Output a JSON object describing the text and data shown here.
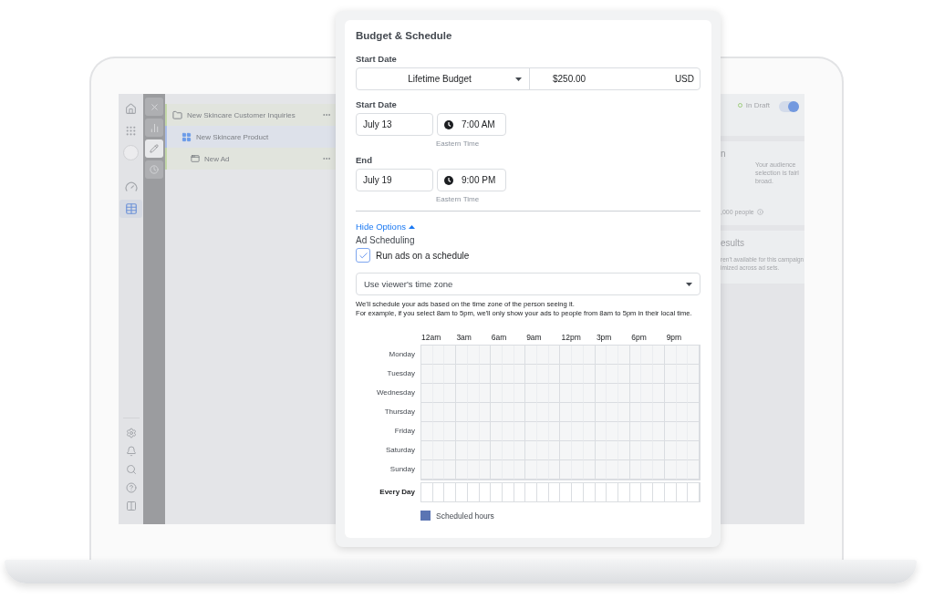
{
  "app": {
    "nav": [
      {
        "kind": "home",
        "selected": false
      },
      {
        "kind": "apps",
        "selected": false
      },
      {
        "kind": "brand",
        "selected": false
      },
      {
        "kind": "gauge",
        "selected": false
      },
      {
        "kind": "table",
        "selected": true
      }
    ],
    "nav_bottom": [
      {
        "kind": "settings"
      },
      {
        "kind": "alerts"
      },
      {
        "kind": "search"
      },
      {
        "kind": "help"
      },
      {
        "kind": "panel"
      }
    ],
    "tools": [
      {
        "kind": "close",
        "selected": false
      },
      {
        "kind": "chart",
        "selected": false
      },
      {
        "kind": "edit",
        "selected": true
      },
      {
        "kind": "history",
        "selected": false
      }
    ],
    "tree": [
      {
        "label": "New Skincare Customer Inquiries",
        "kind": "campaign",
        "selected": false,
        "has_menu": true,
        "children": [
          {
            "label": "New Skincare Product",
            "kind": "adset",
            "selected": true,
            "has_menu": false,
            "children": [
              {
                "label": "New Ad",
                "kind": "ad",
                "selected": false,
                "has_menu": true
              }
            ]
          }
        ]
      }
    ],
    "status": {
      "label": "In Draft",
      "on": true
    },
    "audience_card": {
      "title": "n",
      "note": "Your audience\nselection is fairl\nbroad.",
      "reach": ",000 people"
    },
    "results_card": {
      "title": "esults",
      "text": "ren't available for this campaign\nimized across ad sets."
    }
  },
  "modal": {
    "title": "Budget & Schedule",
    "budget": {
      "label": "Start Date",
      "type": "Lifetime Budget",
      "amount": "$250.00",
      "currency": "USD"
    },
    "periods": [
      {
        "label": "Start Date",
        "date": "July 13",
        "time": "7:00 AM",
        "timezone": "Eastern Time"
      },
      {
        "label": "End",
        "date": "July 19",
        "time": "9:00 PM",
        "timezone": "Eastern Time"
      }
    ],
    "options_link": {
      "label": "Hide Options",
      "expanded": true
    },
    "section_title": "Ad Scheduling",
    "schedule_checkbox": {
      "label": "Run ads on a schedule",
      "checked": true
    },
    "timezone_select": "Use viewer's time zone",
    "help": [
      "We'll schedule your ads based on the time zone of the person seeing it.",
      "For example, if you select 8am to 5pm, we'll only show your ads to people from 8am to 5pm in their local time."
    ],
    "schedule": {
      "hours": [
        "12am",
        "3am",
        "6am",
        "9am",
        "12pm",
        "3pm",
        "6pm",
        "9pm"
      ],
      "days": [
        "Monday",
        "Tuesday",
        "Wednesday",
        "Thursday",
        "Friday",
        "Saturday",
        "Sunday"
      ],
      "every_day": "Every Day",
      "legend": "Scheduled hours"
    }
  }
}
